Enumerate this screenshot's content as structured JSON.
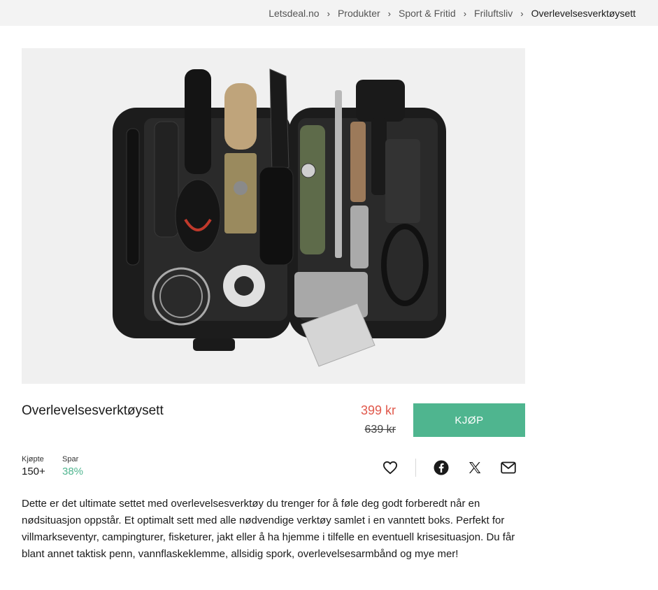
{
  "breadcrumb": {
    "items": [
      "Letsdeal.no",
      "Produkter",
      "Sport & Fritid",
      "Friluftsliv",
      "Overlevelsesverktøysett"
    ]
  },
  "product": {
    "title": "Overlevelsesverktøysett",
    "price": "399 kr",
    "old_price": "639 kr",
    "buy_label": "KJØP",
    "stats": {
      "bought_label": "Kjøpte",
      "bought_value": "150+",
      "save_label": "Spar",
      "save_value": "38%"
    },
    "description": "Dette er det ultimate settet med overlevelsesverktøy du trenger for å føle deg godt forberedt når en nødsituasjon oppstår. Et optimalt sett med alle nødvendige verktøy samlet i en vanntett boks. Perfekt for villmarkseventyr, campingturer, fisketurer, jakt eller å ha hjemme i tilfelle en eventuell krisesituasjon. Du får blant annet taktisk penn, vannflaskeklemme, allsidig spork, overlevelsesarmbånd og mye mer!"
  },
  "icons": [
    "chevron-right-icon",
    "heart-icon",
    "facebook-icon",
    "x-icon",
    "mail-icon"
  ],
  "colors": {
    "accent": "#4fb58f",
    "price": "#e0584b",
    "breadcrumb_bg": "#f3f3f3"
  }
}
